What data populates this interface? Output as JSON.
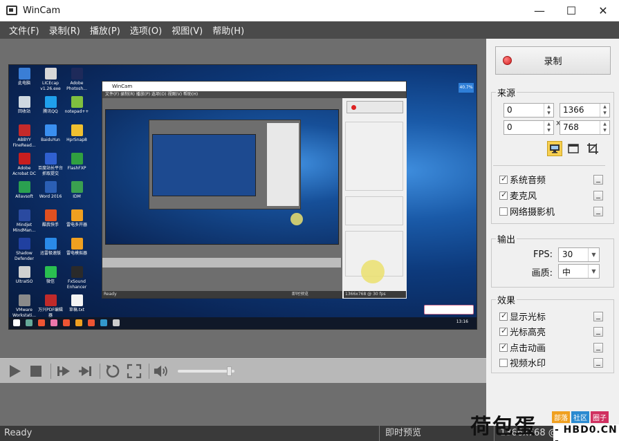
{
  "window": {
    "title": "WinCam",
    "buttons": {
      "minimize": "—",
      "maximize": "☐",
      "close": "✕"
    }
  },
  "menu": [
    {
      "id": "file",
      "label": "文件(F)"
    },
    {
      "id": "record",
      "label": "录制(R)"
    },
    {
      "id": "play",
      "label": "播放(P)"
    },
    {
      "id": "options",
      "label": "选项(O)"
    },
    {
      "id": "view",
      "label": "视图(V)"
    },
    {
      "id": "help",
      "label": "帮助(H)"
    }
  ],
  "preview": {
    "percent_badge": "40.7%",
    "tray_time": "13:16",
    "desktop_icons": [
      {
        "label": "此电脑",
        "color": "#3a7ed6"
      },
      {
        "label": "LICEcap v1.26.exe",
        "color": "#d8d8d8"
      },
      {
        "label": "Adobe Photosh...",
        "color": "#1e2a5a"
      },
      {
        "label": "回收站",
        "color": "#cfd8e0"
      },
      {
        "label": "腾讯QQ",
        "color": "#1fa0ec"
      },
      {
        "label": "notepad++",
        "color": "#7fbf3f"
      },
      {
        "label": "ABBYY FineRead...",
        "color": "#c42a2a"
      },
      {
        "label": "BaiduYun",
        "color": "#3a8ff0"
      },
      {
        "label": "HprSnap8",
        "color": "#f0c030"
      },
      {
        "label": "Adobe Acrobat DC",
        "color": "#c81e1e"
      },
      {
        "label": "百度站长平台抓取提交",
        "color": "#3060d0"
      },
      {
        "label": "FlashFXP",
        "color": "#30a040"
      },
      {
        "label": "Allavsoft",
        "color": "#2aa050"
      },
      {
        "label": "Word 2016",
        "color": "#2b5fb4"
      },
      {
        "label": "IDM",
        "color": "#3aa050"
      },
      {
        "label": "Mindjet MindMan...",
        "color": "#2a4aa0"
      },
      {
        "label": "酷我快手",
        "color": "#e05020"
      },
      {
        "label": "雷电多开器",
        "color": "#f0a020"
      },
      {
        "label": "Shadow Defender",
        "color": "#2040a0"
      },
      {
        "label": "迅雷极速版",
        "color": "#2a8ae8"
      },
      {
        "label": "雷电模拟器",
        "color": "#f0a020"
      },
      {
        "label": "UltraISO",
        "color": "#d0d0d0"
      },
      {
        "label": "微信",
        "color": "#2abf50"
      },
      {
        "label": "FxSound Enhancer",
        "color": "#2a2a2a"
      },
      {
        "label": "VMware Workstati...",
        "color": "#8a8a8a"
      },
      {
        "label": "万兴PDF编辑器",
        "color": "#c02a2a"
      },
      {
        "label": "草稿.txt",
        "color": "#f4f4f4"
      }
    ],
    "inner_window": {
      "title": "WinCam",
      "menu": "文件(F)   录制(R)   播放(P)   选项(O)   视图(V)   帮助(H)",
      "status_ready": "Ready",
      "status_preview": "即时预览",
      "status_res": "1366x768 @ 30 fps"
    }
  },
  "controls": {
    "play": "play-icon",
    "stop": "stop-icon",
    "skip_start": "skip-start-icon",
    "skip_end": "skip-end-icon",
    "loop": "loop-icon",
    "fullscreen": "fullscreen-icon",
    "volume": "volume-icon",
    "volume_level": 0.95
  },
  "status": {
    "ready": "Ready",
    "mode": "即时预览",
    "resolution": "1366x768 @ 30 fps"
  },
  "side": {
    "record_label": "录制",
    "source": {
      "legend": "来源",
      "x": "0",
      "y": "0",
      "width": "1366",
      "height": "768",
      "times": "x",
      "modes": [
        {
          "id": "screen",
          "icon": "monitor-icon",
          "active": true
        },
        {
          "id": "window",
          "icon": "window-icon",
          "active": false
        },
        {
          "id": "region",
          "icon": "crop-icon",
          "active": false
        }
      ],
      "audio": [
        {
          "id": "system-audio",
          "label": "系统音频",
          "checked": true
        },
        {
          "id": "microphone",
          "label": "麦克风",
          "checked": true
        },
        {
          "id": "webcam",
          "label": "网络摄影机",
          "checked": false
        }
      ]
    },
    "output": {
      "legend": "输出",
      "fps_label": "FPS:",
      "fps_value": "30",
      "quality_label": "画质:",
      "quality_value": "中"
    },
    "effects": {
      "legend": "效果",
      "items": [
        {
          "id": "show-cursor",
          "label": "显示光标",
          "checked": true
        },
        {
          "id": "cursor-highlight",
          "label": "光标高亮",
          "checked": true
        },
        {
          "id": "click-animation",
          "label": "点击动画",
          "checked": true
        },
        {
          "id": "video-watermark",
          "label": "视频水印",
          "checked": false
        }
      ]
    }
  },
  "watermark": {
    "brand": "荷包蛋",
    "tags": [
      "部落",
      "社区",
      "圈子"
    ],
    "url": "- HBD0.CN -",
    "colors": {
      "tag1": "#f0a020",
      "tag2": "#2a8ad0",
      "tag3": "#d03060"
    }
  }
}
